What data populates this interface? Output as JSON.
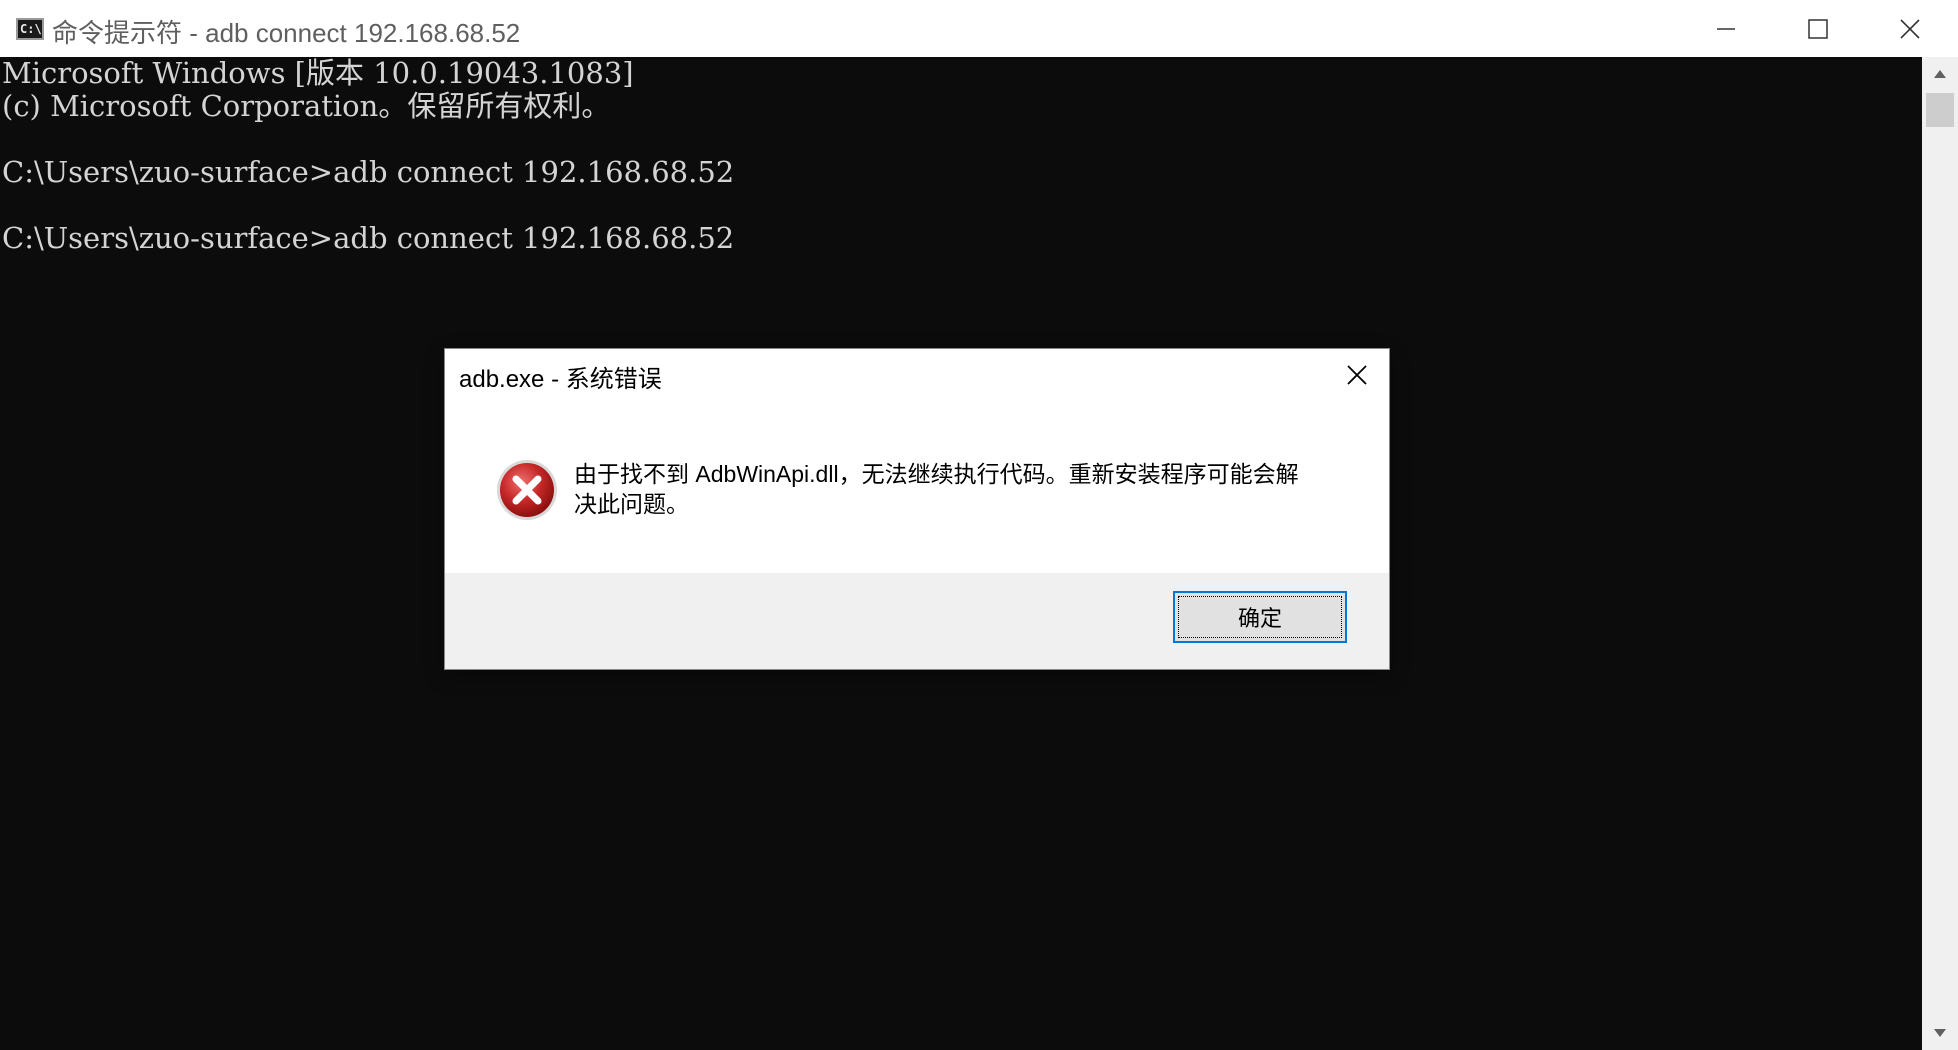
{
  "window": {
    "title": "命令提示符 - adb  connect 192.168.68.52",
    "icon_glyph": "C:\\",
    "icon": "console-icon"
  },
  "console": {
    "lines": [
      "Microsoft Windows [版本 10.0.19043.1083]",
      "(c) Microsoft Corporation。保留所有权利。",
      "",
      "C:\\Users\\zuo-surface>adb connect 192.168.68.52",
      "",
      "C:\\Users\\zuo-surface>adb connect 192.168.68.52"
    ],
    "background": "#0c0c0c",
    "foreground": "#d4d4d4"
  },
  "dialog": {
    "title": "adb.exe - 系统错误",
    "message_line1": "由于找不到 AdbWinApi.dll，无法继续执行代码。重新安装程序可能会解",
    "message_line2": "决此问题。",
    "ok_label": "确定",
    "icon": "error-icon",
    "accent": "#0078d7"
  },
  "colors": {
    "error_red": "#c62828"
  }
}
